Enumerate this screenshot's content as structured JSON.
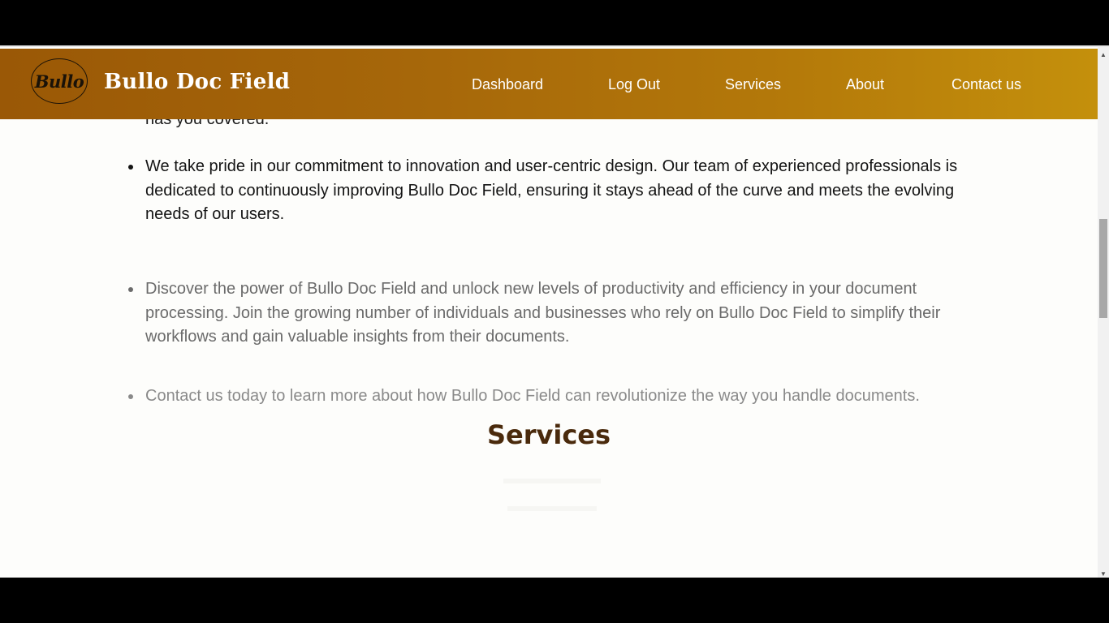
{
  "navbar": {
    "logo_text": "Bullo",
    "brand": "Bullo Doc Field",
    "links": [
      "Dashboard",
      "Log Out",
      "Services",
      "About",
      "Contact us"
    ]
  },
  "content": {
    "fragment": "has you covered.",
    "bullets": [
      "We take pride in our commitment to innovation and user-centric design. Our team of experienced professionals is dedicated to continuously improving Bullo Doc Field, ensuring it stays ahead of the curve and meets the evolving needs of our users.",
      "Discover the power of Bullo Doc Field and unlock new levels of productivity and efficiency in your document processing. Join the growing number of individuals and businesses who rely on Bullo Doc Field to simplify their workflows and gain valuable insights from their documents.",
      "Contact us today to learn more about how Bullo Doc Field can revolutionize the way you handle documents."
    ],
    "services_heading": "Services"
  },
  "scrollbar": {
    "up_icon": "chevron-up-icon",
    "down_icon": "chevron-down-icon"
  }
}
